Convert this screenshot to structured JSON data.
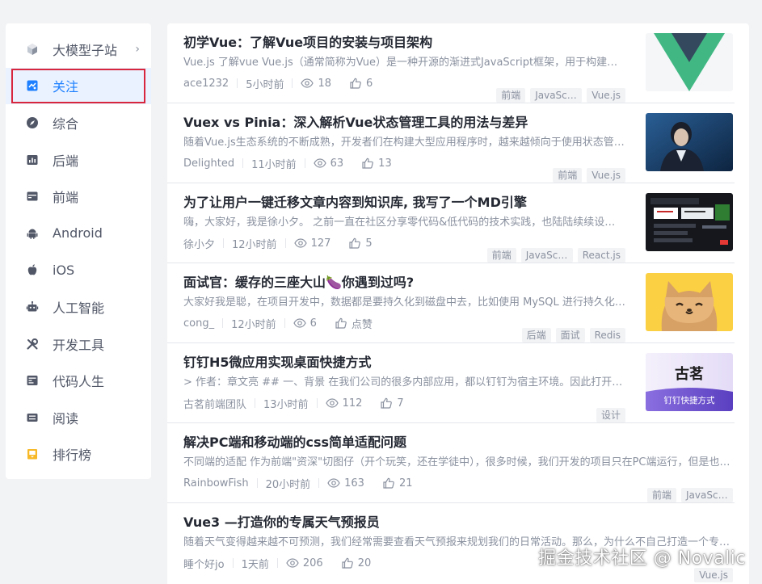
{
  "sidebar": {
    "items": [
      {
        "label": "大模型子站",
        "icon": "cube-icon",
        "has_chevron": true
      },
      {
        "label": "关注",
        "icon": "follow-icon",
        "active": true
      },
      {
        "label": "综合",
        "icon": "compass-icon"
      },
      {
        "label": "后端",
        "icon": "chart-icon"
      },
      {
        "label": "前端",
        "icon": "window-icon"
      },
      {
        "label": "Android",
        "icon": "android-icon"
      },
      {
        "label": "iOS",
        "icon": "apple-icon"
      },
      {
        "label": "人工智能",
        "icon": "robot-icon"
      },
      {
        "label": "开发工具",
        "icon": "tools-icon"
      },
      {
        "label": "代码人生",
        "icon": "code-life-icon"
      },
      {
        "label": "阅读",
        "icon": "read-icon"
      },
      {
        "label": "排行榜",
        "icon": "ranking-icon"
      }
    ],
    "chevron": "›"
  },
  "feed": {
    "entries": [
      {
        "title": "初学Vue：了解Vue项目的安装与项目架构",
        "abstract": "Vue.js 了解vue Vue.js（通常简称为Vue）是一种开源的渐进式JavaScript框架，用于构建用户界面",
        "author": "ace1232",
        "time": "5小时前",
        "views": "18",
        "likes": "6",
        "tags": [
          "前端",
          "JavaScript",
          "Vue.js"
        ],
        "thumb": "vue-logo"
      },
      {
        "title": "Vuex vs Pinia：深入解析Vue状态管理工具的用法与差异",
        "abstract": "随着Vue.js生态系统的不断成熟，开发者们在构建大型应用程序时，越来越倾向于使用状态管理工具",
        "author": "Delighted",
        "time": "11小时前",
        "views": "63",
        "likes": "13",
        "tags": [
          "前端",
          "Vue.js"
        ],
        "thumb": "portrait-photo"
      },
      {
        "title": "为了让用户一键迁移文章内容到知识库, 我写了一个MD引擎",
        "abstract": "嗨，大家好，我是徐小夕。 之前一直在社区分享零代码&低代码的技术实践，也陆陆续续设计开发了多款",
        "author": "徐小夕",
        "time": "12小时前",
        "views": "127",
        "likes": "5",
        "tags": [
          "前端",
          "JavaScript",
          "React.js"
        ],
        "thumb": "app-screenshot"
      },
      {
        "title": "面试官：缓存的三座大山🍆你遇到过吗?",
        "abstract": "大家好我是聪，在项目开发中，数据都是要持久化到磁盘中去，比如使用 MySQL 进行持久化存储",
        "author": "cong_",
        "time": "12小时前",
        "views": "6",
        "likes": "点赞",
        "tags": [
          "后端",
          "面试",
          "Redis"
        ],
        "thumb": "cat-illustration"
      },
      {
        "title": "钉钉H5微应用实现桌面快捷方式",
        "abstract": "> 作者：章文亮 ## 一、背景 在我们公司的很多内部应用，都以钉钉为宿主环境。因此打开应用都要",
        "author": "古茗前端团队",
        "time": "13小时前",
        "views": "112",
        "likes": "7",
        "tags": [
          "设计"
        ],
        "thumb": "dingtalk-banner",
        "thumb_text": "古茗",
        "thumb_sub": "钉钉快捷方式"
      },
      {
        "title": "解决PC端和移动端的css简单适配问题",
        "abstract": "不同端的适配 作为前端\"资深\"切图仔（开个玩笑，还在学徒中），很多时候，我们开发的项目只在PC端运行，但是也会有一些项目需要兼容移动端",
        "author": "RainbowFish",
        "time": "20小时前",
        "views": "163",
        "likes": "21",
        "tags": [
          "前端",
          "JavaScript"
        ],
        "thumb": null
      },
      {
        "title": "Vue3 —打造你的专属天气预报员",
        "abstract": "随着天气变得越来越不可预测，我们经常需要查看天气预报来规划我们的日常活动。那么，为什么不自己打造一个专属的天气预报员呢",
        "author": "睡个好jo",
        "time": "1天前",
        "views": "206",
        "likes": "20",
        "tags": [
          "Vue.js"
        ],
        "thumb": null
      }
    ]
  },
  "watermark": "掘金技术社区 @ Novalic",
  "colors": {
    "accent": "#1e80ff",
    "highlight_box": "#d7263d",
    "vue_green": "#41b883",
    "vue_dark": "#35495e"
  }
}
